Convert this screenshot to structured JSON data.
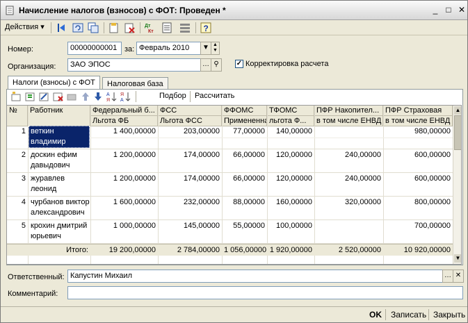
{
  "window": {
    "title": "Начисление налогов (взносов) с ФОТ: Проведен *"
  },
  "toolbar": {
    "actions_label": "Действия",
    "icons": [
      "arrow-left-icon",
      "refresh-icon",
      "swap-icon",
      "doc-edit-icon",
      "doc-delete-icon",
      "dt-kt-icon",
      "report-icon",
      "list-icon",
      "help-icon"
    ]
  },
  "form": {
    "number_label": "Номер:",
    "number_value": "00000000001",
    "period_label": "за:",
    "period_value": "Февраль 2010",
    "org_label": "Организация:",
    "org_value": "ЗАО ЭПОС",
    "correction_label": "Корректировка расчета",
    "correction_checked": true,
    "responsible_label": "Ответственный:",
    "responsible_value": "Капустин Михаил",
    "comment_label": "Комментарий:",
    "comment_value": ""
  },
  "tabs": [
    {
      "label": "Налоги (взносы) с ФОТ",
      "active": true
    },
    {
      "label": "Налоговая база",
      "active": false
    }
  ],
  "table_toolbar": {
    "select_label": "Подбор",
    "calculate_label": "Рассчитать"
  },
  "table": {
    "headers_top": [
      "№",
      "Работник",
      "Федеральный б...",
      "ФСС",
      "ФФОМС",
      "ТФОМС",
      "ПФР Накопител...",
      "ПФР Страховая"
    ],
    "headers_bottom": [
      "",
      "",
      "Льгота ФБ",
      "Льгота ФСС",
      "Примененная",
      "льгота Ф...",
      "в том числе ЕНВД",
      "в том числе ЕНВД"
    ],
    "rows": [
      {
        "n": "1",
        "name1": "веткин",
        "name2": "владимир",
        "fb": "1 400,00000",
        "fss": "203,00000",
        "ffoms": "77,00000",
        "tfoms": "140,00000",
        "pfr_n": "",
        "pfr_s": "980,00000"
      },
      {
        "n": "2",
        "name1": "доскин ефим",
        "name2": "давыдович",
        "fb": "1 200,00000",
        "fss": "174,00000",
        "ffoms": "66,00000",
        "tfoms": "120,00000",
        "pfr_n": "240,00000",
        "pfr_s": "600,00000"
      },
      {
        "n": "3",
        "name1": "журавлев",
        "name2": "леонид",
        "fb": "1 200,00000",
        "fss": "174,00000",
        "ffoms": "66,00000",
        "tfoms": "120,00000",
        "pfr_n": "240,00000",
        "pfr_s": "600,00000"
      },
      {
        "n": "4",
        "name1": "чурбанов виктор",
        "name2": "александрович",
        "fb": "1 600,00000",
        "fss": "232,00000",
        "ffoms": "88,00000",
        "tfoms": "160,00000",
        "pfr_n": "320,00000",
        "pfr_s": "800,00000"
      },
      {
        "n": "5",
        "name1": "крохин дмитрий",
        "name2": "юрьевич",
        "fb": "1 000,00000",
        "fss": "145,00000",
        "ffoms": "55,00000",
        "tfoms": "100,00000",
        "pfr_n": "",
        "pfr_s": "700,00000"
      }
    ],
    "totals": {
      "label": "Итого:",
      "fb": "19 200,00000",
      "fss": "2 784,00000",
      "ffoms": "1 056,00000",
      "tfoms": "1 920,00000",
      "pfr_n": "2 520,00000",
      "pfr_s": "10 920,00000"
    }
  },
  "footer": {
    "ok_label": "OK",
    "save_label": "Записать",
    "close_label": "Закрыть"
  },
  "colors": {
    "selection": "#0a246a",
    "panel": "#ece9d8"
  }
}
